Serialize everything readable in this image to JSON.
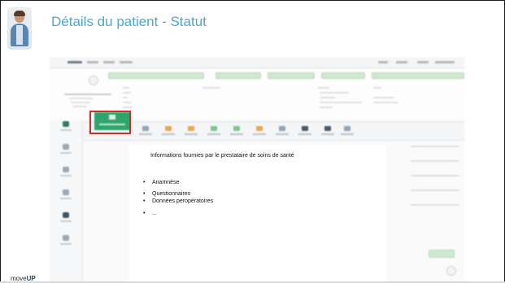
{
  "slide": {
    "title": "Détails du patient - Statut",
    "logo_prefix": "move",
    "logo_suffix": "UP"
  },
  "overlay": {
    "heading": "Informations fournies par le prestataire de soins de santé",
    "items": [
      "Anamnèse",
      "Questionnaires",
      "Données peropératoires",
      "..."
    ],
    "bullet": "•"
  },
  "colors": {
    "title": "#4aa8d4",
    "active_tab": "#2ea56b",
    "highlight": "#d62b2b"
  },
  "icons": [
    "doctor-avatar-icon"
  ]
}
